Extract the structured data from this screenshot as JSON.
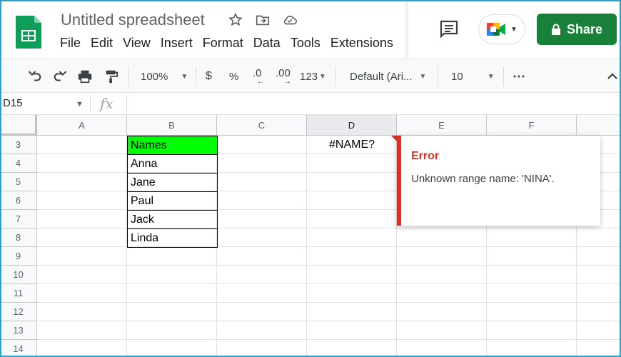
{
  "app": {
    "title": "Untitled spreadsheet",
    "menu": [
      "File",
      "Edit",
      "View",
      "Insert",
      "Format",
      "Data",
      "Tools",
      "Extensions"
    ],
    "share_label": "Share",
    "icons": {
      "logo": "google-sheets-logo",
      "star": "star-icon",
      "move": "move-to-folder-icon",
      "cloud": "cloud-saved-icon",
      "comment": "comment-icon",
      "meet": "google-meet-icon",
      "lock": "lock-icon"
    }
  },
  "toolbar": {
    "zoom": "100%",
    "currency": "$",
    "percent": "%",
    "decrease_decimal": ".0",
    "increase_decimal": ".00",
    "number_format": "123",
    "font": "Default (Ari...",
    "font_size": "10",
    "more": "⋯"
  },
  "formula_bar": {
    "name_box": "D15",
    "fx": "fx",
    "content": ""
  },
  "columns": [
    "A",
    "B",
    "C",
    "D",
    "E",
    "F"
  ],
  "rows": [
    "3",
    "4",
    "5",
    "6",
    "7",
    "8",
    "9",
    "10",
    "11",
    "12",
    "13",
    "14"
  ],
  "cells": {
    "B3": "Names",
    "B4": "Anna",
    "B5": "Jane",
    "B6": "Paul",
    "B7": "Jack",
    "B8": "Linda",
    "D3": "#NAME?"
  },
  "colors": {
    "accent": "#188038",
    "error": "#d93025",
    "header_fill": "#00ff00"
  },
  "error_popup": {
    "title": "Error",
    "message": "Unknown range name: 'NINA'."
  }
}
